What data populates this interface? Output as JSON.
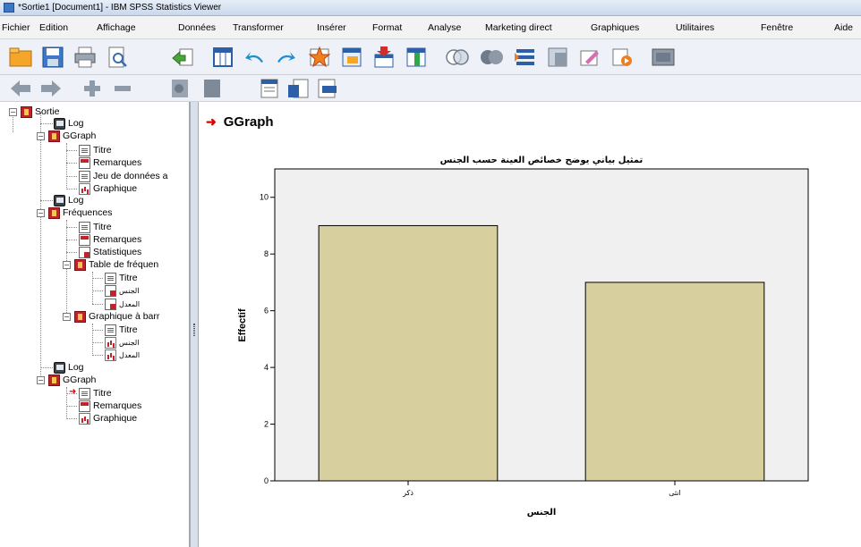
{
  "window": {
    "title": "*Sortie1 [Document1] - IBM SPSS Statistics Viewer"
  },
  "menu": [
    {
      "label": "Fichier"
    },
    {
      "label": "Edition"
    },
    {
      "label": "Affichage"
    },
    {
      "label": "Données"
    },
    {
      "label": "Transformer"
    },
    {
      "label": "Insérer"
    },
    {
      "label": "Format"
    },
    {
      "label": "Analyse"
    },
    {
      "label": "Marketing direct"
    },
    {
      "label": "Graphiques"
    },
    {
      "label": "Utilitaires"
    },
    {
      "label": "Fenêtre"
    },
    {
      "label": "Aide"
    }
  ],
  "toolbar_icons": [
    "open-icon",
    "save-icon",
    "print-icon",
    "print-preview-icon",
    "export-icon",
    "goto-data-icon",
    "undo-icon",
    "redo-icon",
    "goto-case-icon",
    "goto-variable-icon",
    "insert-cases-icon",
    "insert-variable-icon",
    "venn-icon",
    "circles-icon",
    "split-file-icon",
    "weight-cases-icon",
    "select-cases-icon",
    "value-labels-icon",
    "use-sets-icon"
  ],
  "toolbar2_icons": [
    "back-icon",
    "forward-icon",
    "expand-icon",
    "collapse-icon",
    "show-icon",
    "hide-icon",
    "insert-heading-icon",
    "insert-title-icon",
    "insert-text-icon"
  ],
  "tree": {
    "root": "Sortie",
    "log1": "Log",
    "ggraph1": "GGraph",
    "g1_titre": "Titre",
    "g1_rem": "Remarques",
    "g1_jeu": "Jeu de données a",
    "g1_graph": "Graphique",
    "log2": "Log",
    "freq": "Fréquences",
    "f_titre": "Titre",
    "f_rem": "Remarques",
    "f_stat": "Statistiques",
    "f_table": "Table de fréquen",
    "t_titre": "Titre",
    "t_gender": "الجنس",
    "t_avg": "المعدل",
    "f_bar": "Graphique à barr",
    "b_titre": "Titre",
    "b_gender": "الجنس",
    "b_avg": "المعدل",
    "log3": "Log",
    "ggraph2": "GGraph",
    "g2_titre": "Titre",
    "g2_rem": "Remarques",
    "g2_graph": "Graphique"
  },
  "output": {
    "heading": "GGraph"
  },
  "chart_data": {
    "type": "bar",
    "title": "تمثيل بياني يوضح خصائص العينة حسب الجنس",
    "xlabel": "الجنس",
    "ylabel": "Effectif",
    "categories": [
      "ذكر",
      "انثى"
    ],
    "values": [
      9,
      7
    ],
    "ylim": [
      0,
      11
    ],
    "yticks": [
      0,
      2,
      4,
      6,
      8,
      10
    ],
    "bar_color": "#d8cf9e",
    "plot_background": "#f0f0f0"
  }
}
